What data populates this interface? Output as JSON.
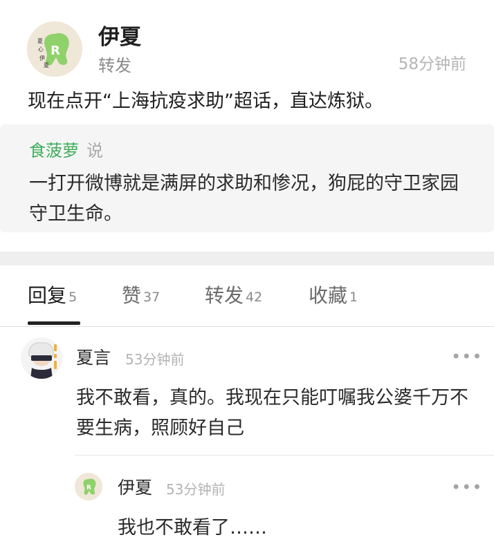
{
  "post": {
    "author": "伊夏",
    "action": "转发",
    "time": "58分钟前",
    "text": "现在点开“上海抗疫求助”超话，直达炼狱。",
    "avatar_icon": "avatar-cartoon-green-icon",
    "avatar_glyphs": [
      "夏",
      "心",
      "伊",
      "夏"
    ]
  },
  "quote": {
    "user": "食菠萝",
    "says": "说",
    "text": "一打开微博就是满屏的求助和惨况，狗屁的守卫家园守卫生命。"
  },
  "tabs": [
    {
      "label": "回复",
      "count": "5"
    },
    {
      "label": "赞",
      "count": "37"
    },
    {
      "label": "转发",
      "count": "42"
    },
    {
      "label": "收藏",
      "count": "1"
    }
  ],
  "comments": [
    {
      "user": "夏言",
      "time": "53分钟前",
      "text": "我不敢看，真的。我现在只能叮嘱我公婆千万不要生病，照顾好自己",
      "more": "•••",
      "avatar_icon": "avatar-anime-character-icon"
    },
    {
      "user": "伊夏",
      "time": "53分钟前",
      "text": "我也不敢看了……",
      "more": "•••",
      "avatar_icon": "avatar-cartoon-green-icon"
    }
  ],
  "colors": {
    "accent_green": "#3fae5b",
    "quote_bg": "#f5f5f5",
    "muted": "#b3b3b3"
  }
}
